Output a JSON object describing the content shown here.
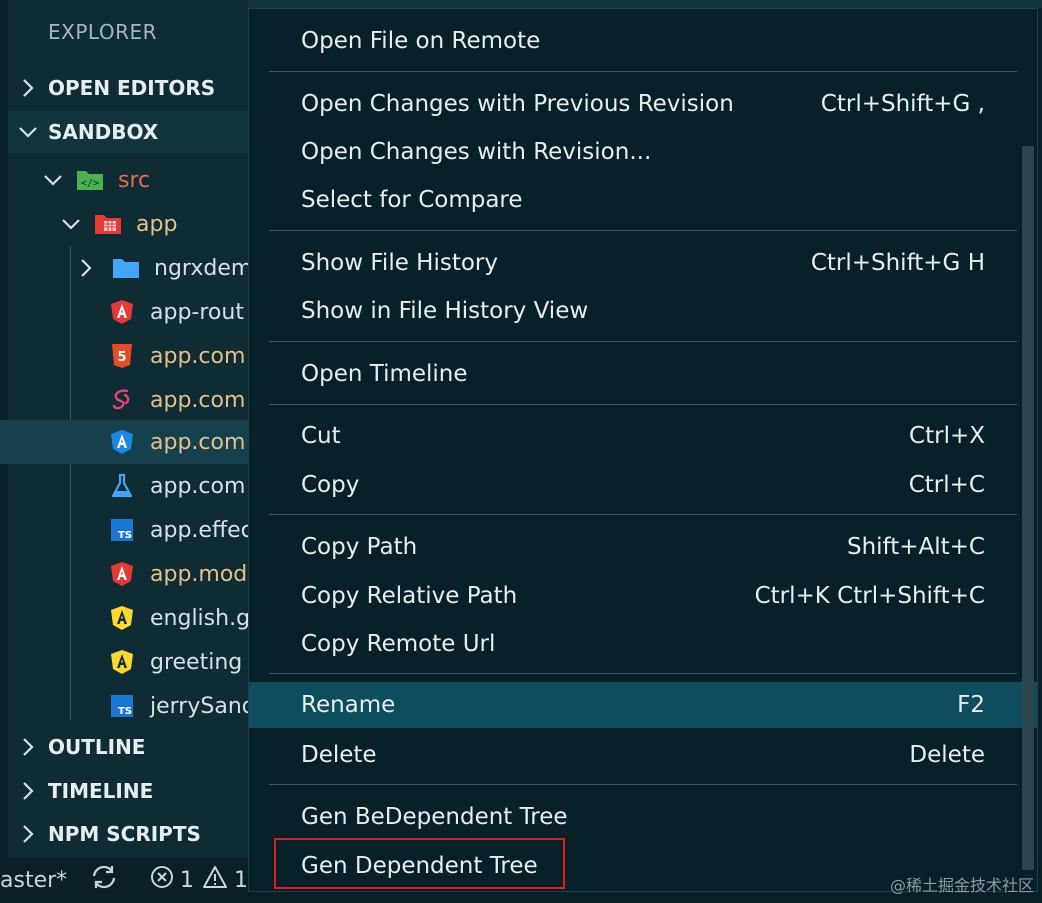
{
  "sidebar": {
    "title": "EXPLORER",
    "sections": {
      "open_editors": "OPEN EDITORS",
      "sandbox": "SANDBOX",
      "outline": "OUTLINE",
      "timeline": "TIMELINE",
      "npm_scripts": "NPM SCRIPTS"
    },
    "tree": {
      "src": "src",
      "app": "app",
      "files": [
        {
          "name": "ngrxdem",
          "icon": "folder-icon",
          "color": "#d4e1e6"
        },
        {
          "name": "app-rout",
          "icon": "angular-icon",
          "color": "#d4e1e6"
        },
        {
          "name": "app.com",
          "icon": "html5-icon",
          "color": "#e2c08d"
        },
        {
          "name": "app.com",
          "icon": "sass-icon",
          "color": "#e2c08d"
        },
        {
          "name": "app.com",
          "icon": "angular-component-icon",
          "color": "#e2c08d"
        },
        {
          "name": "app.com",
          "icon": "flask-icon",
          "color": "#d4e1e6"
        },
        {
          "name": "app.effec",
          "icon": "typescript-icon",
          "color": "#d4e1e6"
        },
        {
          "name": "app.mod",
          "icon": "angular-icon",
          "color": "#e2c08d"
        },
        {
          "name": "english.g",
          "icon": "angular-yellow-icon",
          "color": "#d4e1e6"
        },
        {
          "name": "greeting",
          "icon": "angular-yellow-icon",
          "color": "#d4e1e6"
        },
        {
          "name": "jerrySand",
          "icon": "typescript-icon",
          "color": "#d4e1e6"
        }
      ]
    }
  },
  "context_menu": {
    "items": [
      {
        "label": "Open File on Remote",
        "shortcut": ""
      },
      {
        "label": "Open Changes with Previous Revision",
        "shortcut": "Ctrl+Shift+G ,"
      },
      {
        "label": "Open Changes with Revision...",
        "shortcut": ""
      },
      {
        "label": "Select for Compare",
        "shortcut": ""
      },
      {
        "label": "Show File History",
        "shortcut": "Ctrl+Shift+G H"
      },
      {
        "label": "Show in File History View",
        "shortcut": ""
      },
      {
        "label": "Open Timeline",
        "shortcut": ""
      },
      {
        "label": "Cut",
        "shortcut": "Ctrl+X"
      },
      {
        "label": "Copy",
        "shortcut": "Ctrl+C"
      },
      {
        "label": "Copy Path",
        "shortcut": "Shift+Alt+C"
      },
      {
        "label": "Copy Relative Path",
        "shortcut": "Ctrl+K Ctrl+Shift+C"
      },
      {
        "label": "Copy Remote Url",
        "shortcut": ""
      },
      {
        "label": "Rename",
        "shortcut": "F2"
      },
      {
        "label": "Delete",
        "shortcut": "Delete"
      },
      {
        "label": "Gen BeDependent Tree",
        "shortcut": ""
      },
      {
        "label": "Gen Dependent Tree",
        "shortcut": ""
      }
    ]
  },
  "statusbar": {
    "branch": "aster*",
    "errors": "1",
    "warnings": "1"
  },
  "watermark": "@稀土掘金技术社区",
  "colors": {
    "menu_active": "#0e4d5e",
    "highlight_box": "#e01d1d",
    "modified_file": "#e2c08d",
    "src_folder": "#e56b5b"
  }
}
